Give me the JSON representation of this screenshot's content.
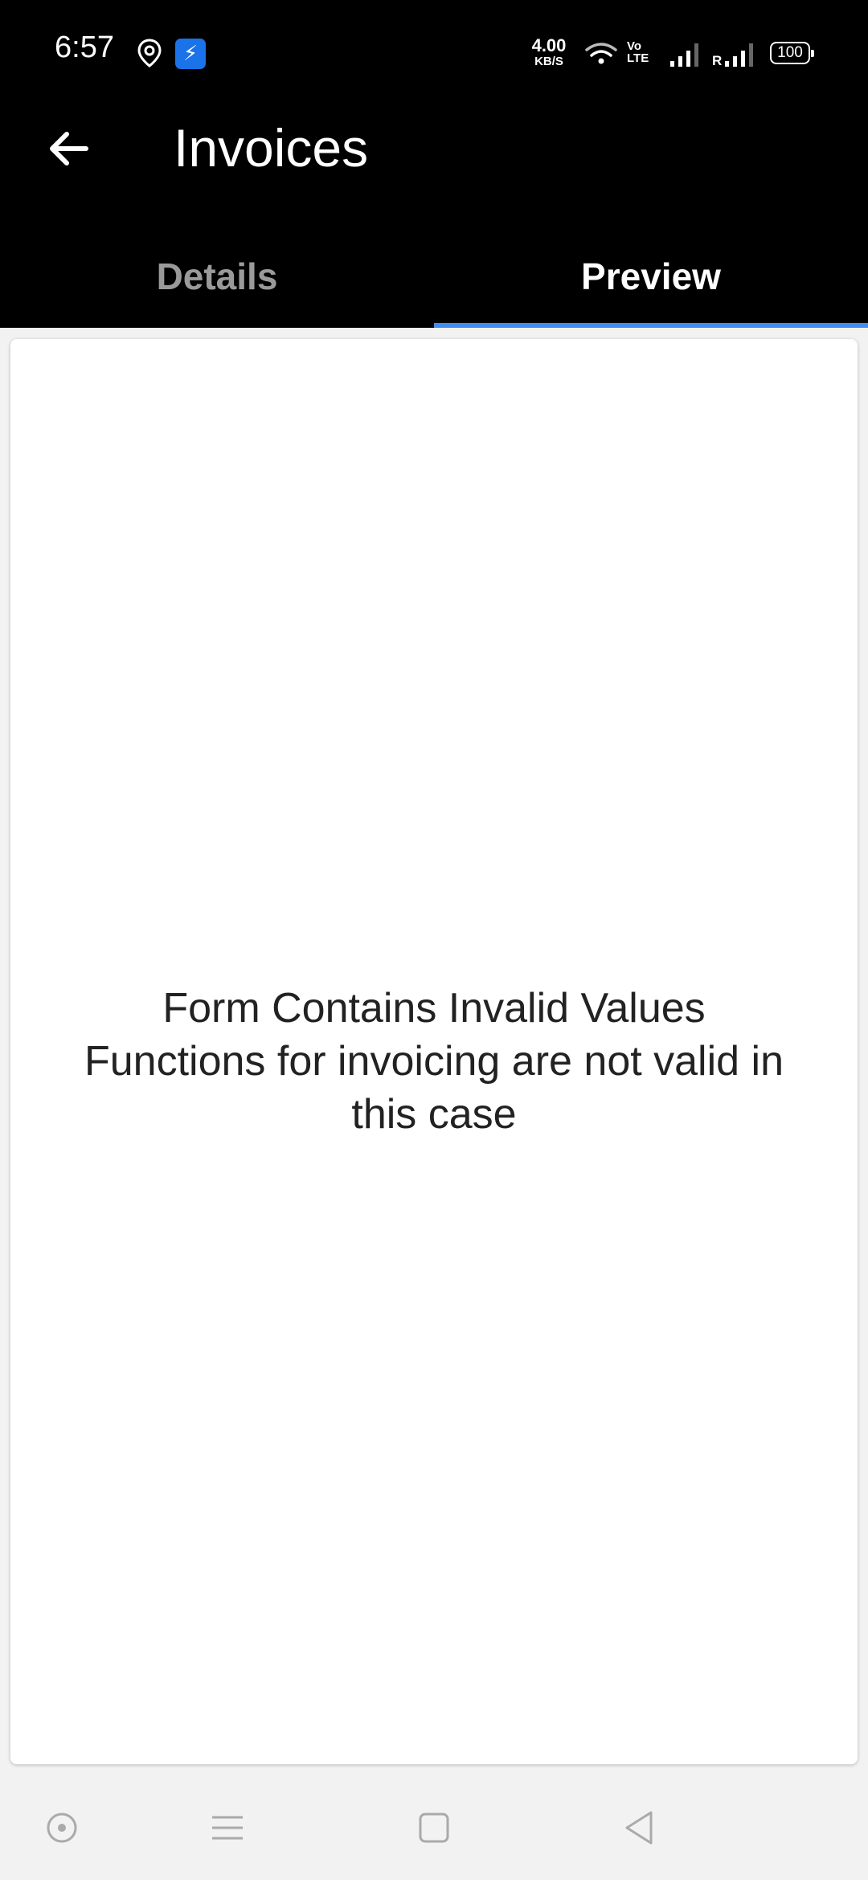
{
  "status_bar": {
    "time": "6:57",
    "net_speed_value": "4.00",
    "net_speed_unit": "KB/S",
    "volte_line1": "Vo",
    "volte_line2": "LTE",
    "sim2_label": "R",
    "battery": "100",
    "icons": [
      "location-icon",
      "usb-icon",
      "wifi-icon",
      "signal-icon",
      "signal-roaming-icon",
      "battery-icon"
    ]
  },
  "app_bar": {
    "title": "Invoices",
    "back_icon": "arrow-left-icon"
  },
  "tabs": [
    {
      "label": "Details",
      "active": false
    },
    {
      "label": "Preview",
      "active": true
    }
  ],
  "preview": {
    "line1": "Form Contains Invalid Values",
    "line2": "Functions for invoicing are not valid in",
    "line3": "this case"
  },
  "nav_bar": {
    "icons": [
      "assistant-icon",
      "recents-menu-icon",
      "home-square-icon",
      "back-triangle-icon"
    ]
  },
  "colors": {
    "app_bar_bg": "#000000",
    "tab_indicator": "#3d8ef0",
    "usb_badge": "#1a73e8",
    "inactive_tab_text": "#9a9a9a"
  }
}
